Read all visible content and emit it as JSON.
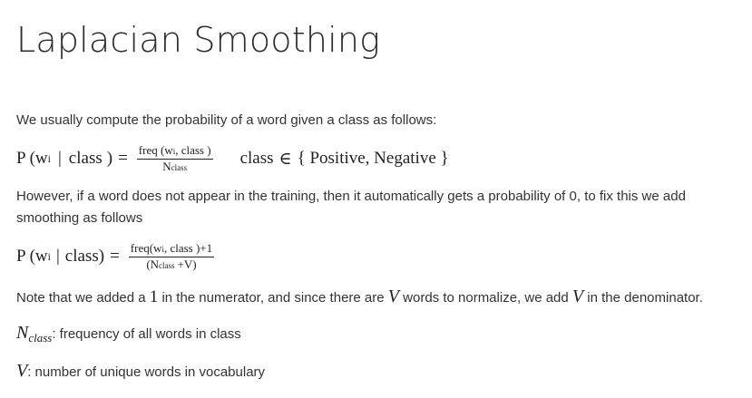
{
  "title": "Laplacian Smoothing",
  "intro": "We usually compute the probability of a word given a class as follows:",
  "eq1": {
    "P": "P",
    "lparen": "(",
    "w": "w",
    "w_sub": "i",
    "bar": "|",
    "class_word": "class",
    "rparen": ")",
    "equals": "=",
    "numerator": "freq (w",
    "numerator_sub": "i",
    "numerator_end": ", class )",
    "denominator": "N",
    "denominator_sub": "class",
    "set_label": "class",
    "in": "∈",
    "set_content": "{ Positive, Negative }"
  },
  "however": {
    "line1": "However, if a word does not appear in the training, then it automatically gets a probability of 0, to fix this we add",
    "line2": "smoothing as follows"
  },
  "eq2": {
    "P": "P",
    "lparen": "(",
    "w": "w",
    "w_sub": "i",
    "bar": "|",
    "class_word": "class)",
    "equals": "=",
    "numerator": "freq(w",
    "numerator_sub": "i",
    "numerator_end": ", class )+1",
    "denominator_open": "(N",
    "denominator_sub": "class",
    "denominator_end": "+V)"
  },
  "note": {
    "before_one": "Note that we added a ",
    "one": "1",
    "mid": " in the numerator, and since there are ",
    "V1": "V",
    "mid2": " words to normalize, we add ",
    "V2": "V",
    "end": " in the denominator."
  },
  "def_n": {
    "symbol": "N",
    "symbol_sub": "class",
    "text": ": frequency of all words in class"
  },
  "def_v": {
    "symbol": "V",
    "text": ": number of unique words in vocabulary"
  }
}
